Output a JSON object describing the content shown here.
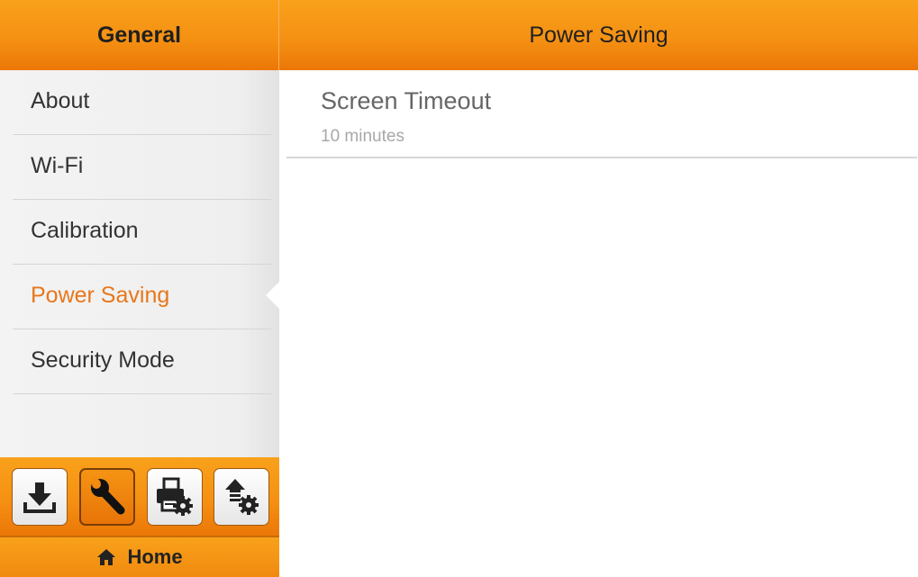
{
  "header": {
    "left_title": "General",
    "right_title": "Power Saving"
  },
  "sidebar": {
    "items": [
      {
        "label": "About"
      },
      {
        "label": "Wi-Fi"
      },
      {
        "label": "Calibration"
      },
      {
        "label": "Power Saving",
        "selected": true
      },
      {
        "label": "Security Mode"
      }
    ]
  },
  "toolbar": {
    "buttons": [
      {
        "icon": "download-icon"
      },
      {
        "icon": "wrench-icon",
        "selected": true
      },
      {
        "icon": "printer-settings-icon"
      },
      {
        "icon": "upload-settings-icon"
      }
    ]
  },
  "home": {
    "label": "Home",
    "icon": "home-icon"
  },
  "content": {
    "setting": {
      "title": "Screen Timeout",
      "value": "10 minutes"
    }
  },
  "colors": {
    "accent": "#f59113",
    "selected_text": "#e8771b"
  }
}
